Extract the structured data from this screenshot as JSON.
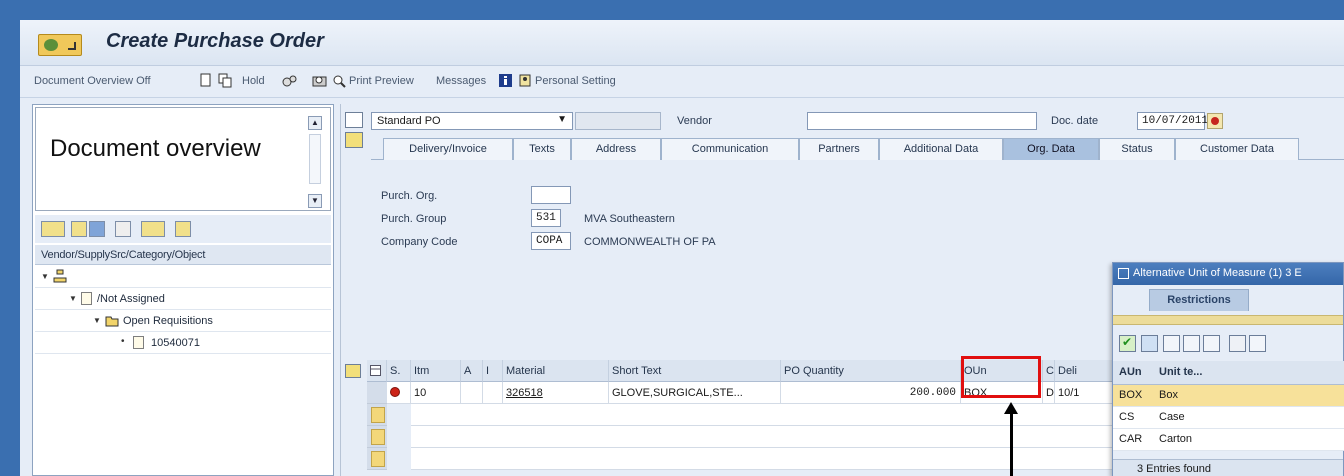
{
  "window": {
    "title": "Create Purchase Order"
  },
  "toolbar": {
    "document_overview": "Document Overview Off",
    "hold": "Hold",
    "print_preview": "Print Preview",
    "messages": "Messages",
    "personal_setting": "Personal Setting"
  },
  "left_pane": {
    "overview_title": "Document overview",
    "column_header": "Vendor/SupplySrc/Category/Object",
    "tree": [
      {
        "label": "/Not Assigned"
      },
      {
        "label": "Open Requisitions"
      },
      {
        "label": "10540071"
      }
    ]
  },
  "header": {
    "po_type": "Standard PO",
    "vendor_label": "Vendor",
    "vendor_value": "",
    "doc_date_label": "Doc. date",
    "doc_date": "10/07/2011"
  },
  "tabs": [
    {
      "label": "Delivery/Invoice"
    },
    {
      "label": "Texts"
    },
    {
      "label": "Address"
    },
    {
      "label": "Communication"
    },
    {
      "label": "Partners"
    },
    {
      "label": "Additional Data"
    },
    {
      "label": "Org. Data"
    },
    {
      "label": "Status"
    },
    {
      "label": "Customer Data"
    }
  ],
  "org_data": {
    "purch_org_label": "Purch. Org.",
    "purch_org_value": "",
    "purch_group_label": "Purch. Group",
    "purch_group_value": "531",
    "purch_group_desc": "MVA Southeastern",
    "company_code_label": "Company Code",
    "company_code_value": "COPA",
    "company_code_desc": "COMMONWEALTH OF PA"
  },
  "items_grid": {
    "columns": [
      "S.",
      "Itm",
      "A",
      "I",
      "Material",
      "Short Text",
      "PO Quantity",
      "OUn",
      "C",
      "Deli"
    ],
    "rows": [
      {
        "item": "10",
        "material": "326518",
        "short_text": "GLOVE,SURGICAL,STE...",
        "po_quantity": "200.000",
        "oun": "BOX",
        "c": "D",
        "deli": "10/1"
      }
    ]
  },
  "popup": {
    "title": "Alternative Unit of Measure (1)   3 E",
    "tab": "Restrictions",
    "col_aun": "AUn",
    "col_unit_text": "Unit te...",
    "rows": [
      {
        "aun": "BOX",
        "unit_text": "Box"
      },
      {
        "aun": "CS",
        "unit_text": "Case"
      },
      {
        "aun": "CAR",
        "unit_text": "Carton"
      }
    ],
    "status": "3 Entries found"
  },
  "colors": {
    "accent": "#3a6fb0",
    "highlight_box": "#e10f0f",
    "selection": "#f7e19a"
  }
}
